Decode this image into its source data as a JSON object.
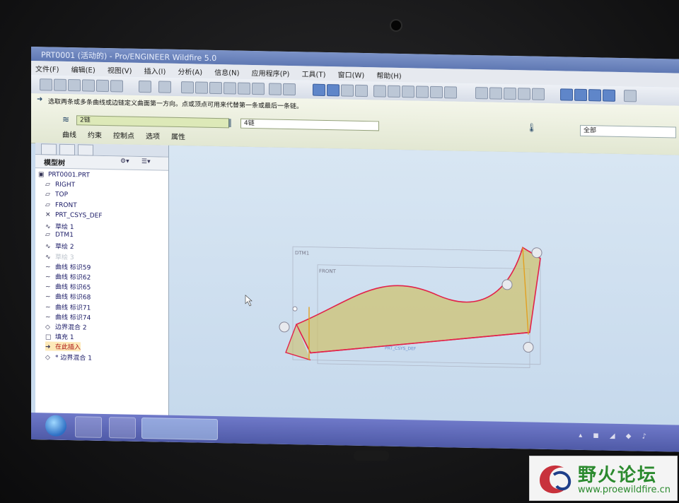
{
  "window": {
    "title": "PRT0001 (活动的) - Pro/ENGINEER Wildfire 5.0"
  },
  "menu": [
    "文件(F)",
    "编辑(E)",
    "视图(V)",
    "插入(I)",
    "分析(A)",
    "信息(N)",
    "应用程序(P)",
    "工具(T)",
    "窗口(W)",
    "帮助(H)"
  ],
  "toolbar": {
    "view_filter": "全部"
  },
  "dashboard": {
    "prompt": "选取两条或多条曲线或边链定义曲面第一方向。点或顶点可用来代替第一条或最后一条链。",
    "first_direction": "2链",
    "second_direction": "4链",
    "tabs": [
      "曲线",
      "约束",
      "控制点",
      "选项",
      "属性"
    ]
  },
  "model_tree": {
    "header": "模型树",
    "items": [
      {
        "label": "PRT0001.PRT",
        "icon": "part-icon"
      },
      {
        "label": "RIGHT",
        "icon": "datum-plane-icon"
      },
      {
        "label": "TOP",
        "icon": "datum-plane-icon"
      },
      {
        "label": "FRONT",
        "icon": "datum-plane-icon"
      },
      {
        "label": "PRT_CSYS_DEF",
        "icon": "csys-icon"
      },
      {
        "label": "草绘 1",
        "icon": "sketch-icon"
      },
      {
        "label": "DTM1",
        "icon": "datum-plane-icon"
      },
      {
        "label": "草绘 2",
        "icon": "sketch-icon"
      },
      {
        "label": "草绘 3",
        "icon": "sketch-icon",
        "hidden": true
      },
      {
        "label": "曲线 标识59",
        "icon": "curve-icon"
      },
      {
        "label": "曲线 标识62",
        "icon": "curve-icon"
      },
      {
        "label": "曲线 标识65",
        "icon": "curve-icon"
      },
      {
        "label": "曲线 标识68",
        "icon": "curve-icon"
      },
      {
        "label": "曲线 标识71",
        "icon": "curve-icon"
      },
      {
        "label": "曲线 标识74",
        "icon": "curve-icon"
      },
      {
        "label": "边界混合 2",
        "icon": "boundary-blend-icon"
      },
      {
        "label": "填充 1",
        "icon": "fill-icon"
      },
      {
        "label": "在此插入",
        "icon": "insert-arrow-icon",
        "insert": true
      },
      {
        "label": "* 边界混合 1",
        "icon": "boundary-blend-icon"
      }
    ]
  },
  "canvas": {
    "labels": {
      "dtm": "DTM1",
      "front": "FRONT",
      "csys": "PRT_CSYS_DEF"
    }
  },
  "watermark": {
    "title": "野火论坛",
    "url": "www.proewildfire.cn"
  },
  "colors": {
    "accent": "#5f78b3",
    "curve": "#e2224a",
    "surface": "#c9b95a"
  }
}
